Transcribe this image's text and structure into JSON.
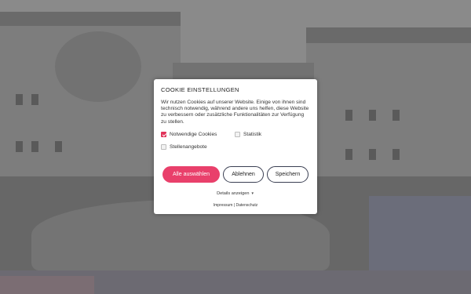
{
  "cookie_modal": {
    "title": "COOKIE EINSTELLUNGEN",
    "description": "Wir nutzen Cookies auf unserer Website. Einige von ihnen sind technisch notwendig, während andere uns helfen, diese Website zu verbessern oder zusätzliche Funktionalitäten zur Verfügung zu stellen.",
    "checkboxes": [
      {
        "label": "Notwendige Cookies",
        "checked": true
      },
      {
        "label": "Statistik",
        "checked": false
      },
      {
        "label": "Stellenangebote",
        "checked": false
      }
    ],
    "buttons": {
      "accept_all": "Alle auswählen",
      "reject": "Ablehnen",
      "save": "Speichern"
    },
    "details_link": "Details anzeigen",
    "footer_links": {
      "imprint": "Impressum",
      "separator": "|",
      "privacy": "Datenschutz"
    }
  },
  "colors": {
    "accent": "#e9406b",
    "button_border": "#3a3f52",
    "overlay": "#6f6f6f"
  }
}
